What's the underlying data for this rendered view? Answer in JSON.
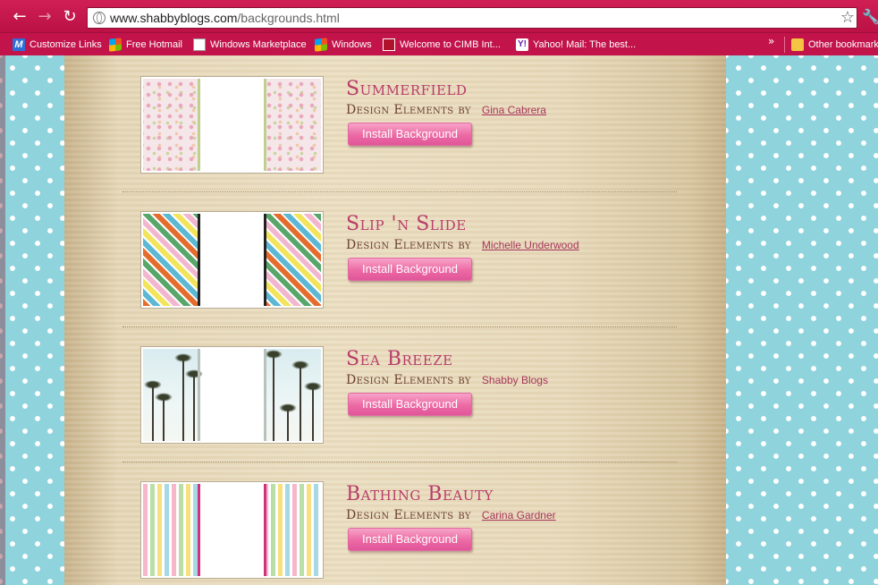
{
  "browser": {
    "url_host": "www.shabbyblogs.com",
    "url_path": "/backgrounds.html",
    "bookmarks": [
      {
        "label": "Customize Links",
        "icon": "msn-icon"
      },
      {
        "label": "Free Hotmail",
        "icon": "windows-flag-icon"
      },
      {
        "label": "Windows Marketplace",
        "icon": "document-icon"
      },
      {
        "label": "Windows",
        "icon": "windows-flag-icon"
      },
      {
        "label": "Welcome to CIMB Int...",
        "icon": "cimb-icon"
      },
      {
        "label": "Yahoo! Mail: The best...",
        "icon": "yahoo-icon"
      }
    ],
    "other_bookmarks": "Other bookmarks",
    "overflow_glyph": "»"
  },
  "colors": {
    "chrome": "#c2144a",
    "title": "#b83d6a",
    "button": "#ec6aa4",
    "side_pattern": "#8fd3dd"
  },
  "backgrounds": [
    {
      "title": "Summerfield",
      "credit_label": "Design Elements by",
      "designer": "Gina Cabrera",
      "designer_is_link": true,
      "button": "Install Background",
      "pattern": "floral"
    },
    {
      "title": "Slip 'n Slide",
      "credit_label": "Design Elements by",
      "designer": "Michelle Underwood",
      "designer_is_link": true,
      "button": "Install Background",
      "pattern": "stripes"
    },
    {
      "title": "Sea Breeze",
      "credit_label": "Design Elements by",
      "designer": "Shabby Blogs",
      "designer_is_link": false,
      "button": "Install Background",
      "pattern": "palms"
    },
    {
      "title": "Bathing Beauty",
      "credit_label": "Design Elements by",
      "designer": "Carina Gardner",
      "designer_is_link": true,
      "button": "Install Background",
      "pattern": "swimsuits"
    }
  ]
}
